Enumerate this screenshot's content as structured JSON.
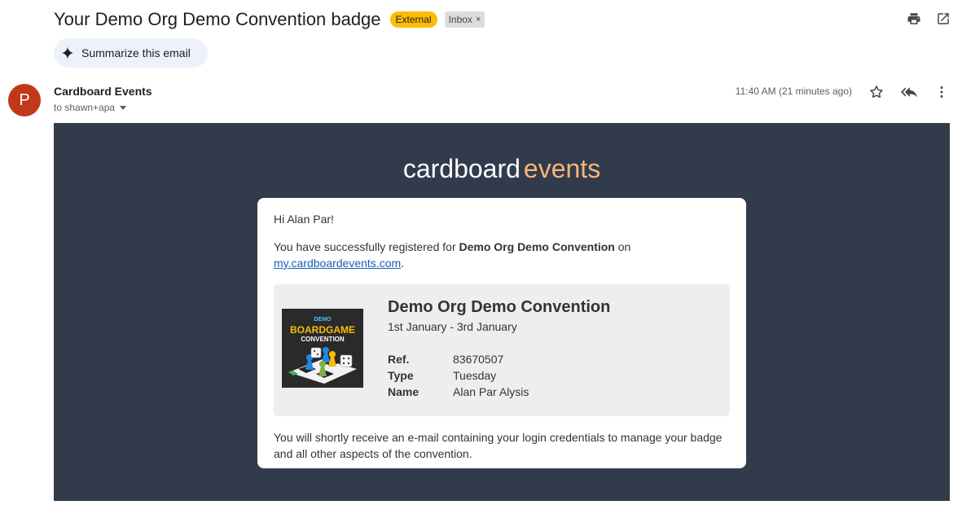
{
  "header": {
    "subject": "Your Demo Org Demo Convention badge",
    "label_external": "External",
    "label_inbox": "Inbox",
    "label_remove": "×",
    "summarize_label": "Summarize this email"
  },
  "icons": {
    "print": "print-icon",
    "open_new_window": "open-in-new-window-icon",
    "star": "star-icon",
    "reply_all": "reply-all-icon",
    "more": "more-vert-icon",
    "spark": "sparkle-icon"
  },
  "message": {
    "avatar_initial": "P",
    "sender": "Cardboard Events",
    "to": "to shawn+apa",
    "timestamp": "11:40 AM (21 minutes ago)"
  },
  "email": {
    "brand_part1": "cardboard",
    "brand_part2": "events",
    "greeting": "Hi Alan Par!",
    "reg_prefix": "You have successfully registered for ",
    "reg_event": "Demo Org Demo Convention",
    "reg_suffix": " on",
    "reg_link": "my.cardboardevents.com",
    "reg_end": ".",
    "event_title": "Demo Org Demo Convention",
    "event_dates": "1st January - 3rd January",
    "logo": {
      "line1": "DEMO",
      "line2": "BOARDGAME",
      "line3": "CONVENTION"
    },
    "details": [
      {
        "key": "Ref.",
        "value": "83670507"
      },
      {
        "key": "Type",
        "value": "Tuesday"
      },
      {
        "key": "Name",
        "value": "Alan Par Alysis"
      }
    ],
    "footer": "You will shortly receive an e-mail containing your login credentials to manage your badge and all other aspects of the convention."
  },
  "colors": {
    "external_badge": "#fbbc04",
    "avatar": "#c0391b",
    "email_bg": "#313b4b",
    "brand_accent": "#f9b677",
    "link": "#1a5fb4"
  }
}
